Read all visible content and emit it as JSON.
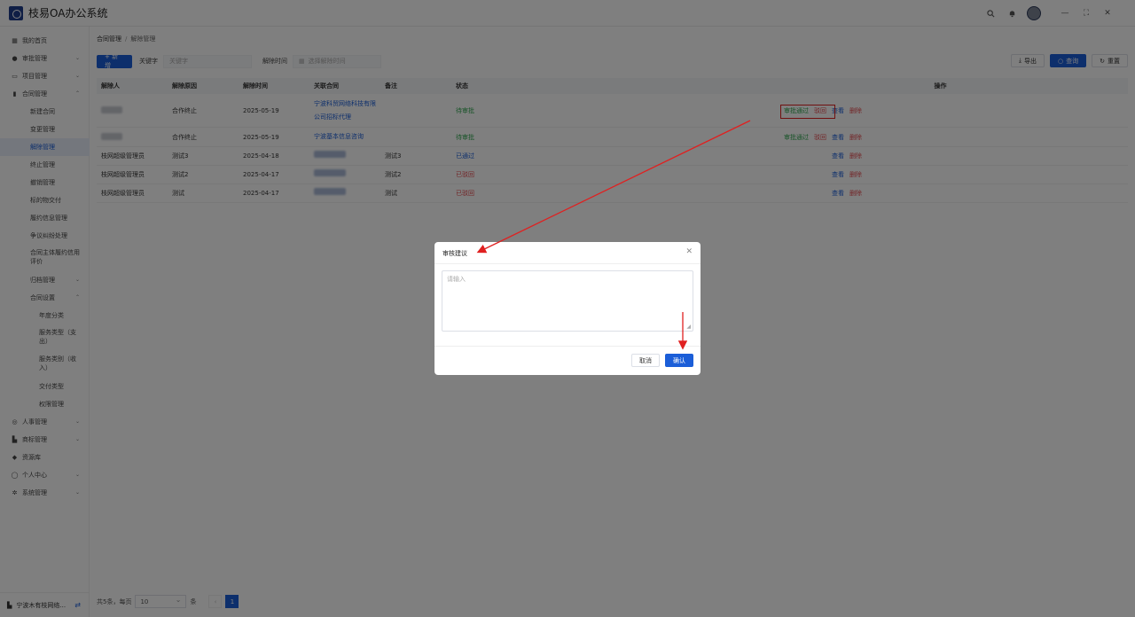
{
  "app": {
    "title": "枝易OA办公系统"
  },
  "sidebar": {
    "items": [
      {
        "label": "我的首页",
        "icon": "grid-icon",
        "chev": ""
      },
      {
        "label": "审批管理",
        "icon": "user-icon",
        "chev": "⌄"
      },
      {
        "label": "项目管理",
        "icon": "folder-icon",
        "chev": "⌄"
      },
      {
        "label": "合同管理",
        "icon": "chart-icon",
        "chev": "⌃"
      },
      {
        "label": "新建合同",
        "sub": true
      },
      {
        "label": "变更管理",
        "sub": true
      },
      {
        "label": "解除管理",
        "sub": true,
        "active": true
      },
      {
        "label": "终止管理",
        "sub": true
      },
      {
        "label": "撤销管理",
        "sub": true
      },
      {
        "label": "标的物交付",
        "sub": true
      },
      {
        "label": "履约信息管理",
        "sub": true
      },
      {
        "label": "争议纠纷处理",
        "sub": true
      },
      {
        "label": "合同主体履约信用评价",
        "sub": true,
        "multi": true
      },
      {
        "label": "归档管理",
        "sub": true,
        "chev": "⌄"
      },
      {
        "label": "合同设置",
        "sub": true,
        "chev": "⌃"
      },
      {
        "label": "年度分类",
        "sub2": true
      },
      {
        "label": "服务类型（支出）",
        "sub2": true,
        "multi": true
      },
      {
        "label": "服务类别（收入）",
        "sub2": true,
        "multi": true
      },
      {
        "label": "交付类型",
        "sub2": true
      },
      {
        "label": "权限管理",
        "sub2": true
      },
      {
        "label": "人事管理",
        "icon": "check-circle-icon",
        "chev": "⌄"
      },
      {
        "label": "商标管理",
        "icon": "factory-icon",
        "chev": "⌄"
      },
      {
        "label": "资源库",
        "icon": "pin-icon",
        "chev": ""
      },
      {
        "label": "个人中心",
        "icon": "person-icon",
        "chev": "⌄"
      },
      {
        "label": "系统管理",
        "icon": "gear-icon",
        "chev": "⌄"
      }
    ],
    "footer": "宁波木有枝网络..."
  },
  "breadcrumb": {
    "root": "合同管理",
    "current": "解除管理"
  },
  "toolbar": {
    "add_label": "+ 新增",
    "keyword_label": "关键字",
    "keyword_placeholder": "关键字",
    "time_label": "解除时间",
    "time_placeholder": "选择解除时间",
    "export_label": "导出",
    "search_label": "查询",
    "reset_label": "重置"
  },
  "table": {
    "headers": [
      "解除人",
      "解除原因",
      "解除时间",
      "关联合同",
      "备注",
      "状态",
      "操作"
    ],
    "rows": [
      {
        "person": "",
        "reason": "合作终止",
        "time": "2025-05-19",
        "contract": "宁波科贸网络科技有限公司招标代理",
        "note": "",
        "status": "待审批",
        "status_type": "success",
        "ops": [
          "审批通过",
          "驳回",
          "查看",
          "删除"
        ]
      },
      {
        "person": "",
        "reason": "合作终止",
        "time": "2025-05-19",
        "contract": "宁波基本信息咨询",
        "note": "",
        "status": "待审批",
        "status_type": "success",
        "ops": [
          "审批通过",
          "驳回",
          "查看",
          "删除"
        ]
      },
      {
        "person": "枝网超级管理员",
        "reason": "测试3",
        "time": "2025-04-18",
        "contract": "",
        "note": "测试3",
        "status": "已通过",
        "status_type": "link",
        "ops": [
          "查看",
          "删除"
        ]
      },
      {
        "person": "枝网超级管理员",
        "reason": "测试2",
        "time": "2025-04-17",
        "contract": "",
        "note": "测试2",
        "status": "已驳回",
        "status_type": "danger",
        "ops": [
          "查看",
          "删除"
        ]
      },
      {
        "person": "枝网超级管理员",
        "reason": "测试",
        "time": "2025-04-17",
        "contract": "",
        "note": "测试",
        "status": "已驳回",
        "status_type": "danger",
        "ops": [
          "查看",
          "删除"
        ]
      }
    ]
  },
  "pagination": {
    "total_text": "共5条，每页",
    "page_size": "10",
    "unit": "条",
    "current_page": "1",
    "prev": "‹"
  },
  "modal": {
    "title": "审核建议",
    "placeholder": "请输入",
    "cancel_label": "取消",
    "confirm_label": "确认"
  },
  "colors": {
    "primary": "#1b5ed8",
    "success": "#33a852",
    "danger": "#e5484d",
    "annotation": "#e02020"
  }
}
